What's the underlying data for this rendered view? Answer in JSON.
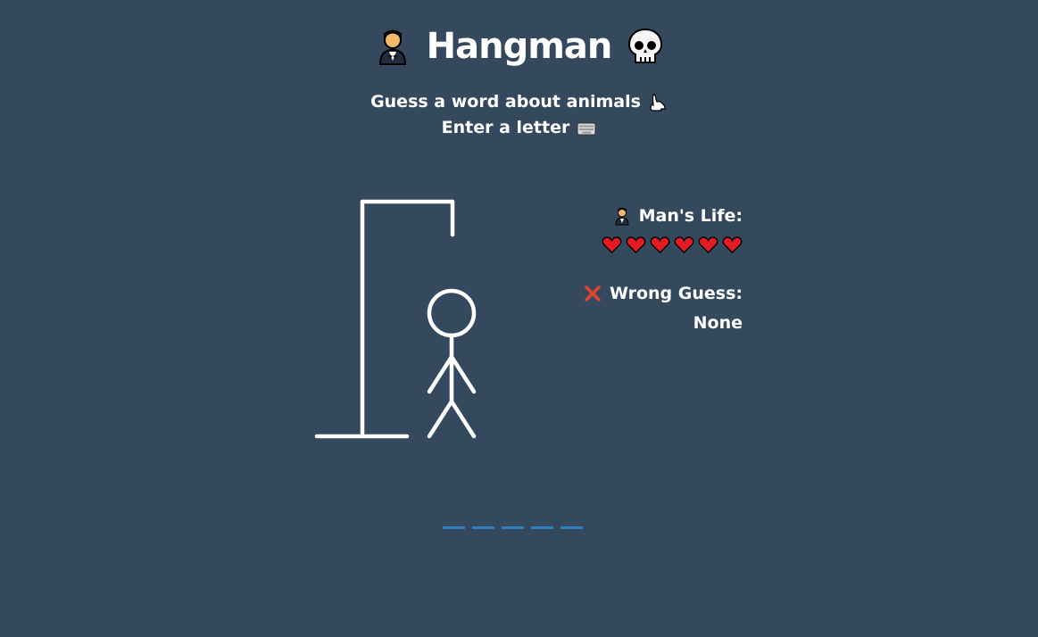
{
  "header": {
    "title": "Hangman",
    "left_icon": "man-in-tuxedo-icon",
    "right_icon": "skull-icon",
    "subtitle_line1": "Guess a word about animals",
    "subtitle_line1_icon": "rabbit-icon",
    "subtitle_line2": "Enter a letter",
    "subtitle_line2_icon": "keyboard-icon"
  },
  "status": {
    "life_label": "Man's Life:",
    "life_icon": "man-in-tuxedo-icon",
    "lives": 6,
    "heart_color": "#e51b23",
    "wrong_label": "Wrong Guess:",
    "wrong_icon": "cross-icon",
    "wrong_value": "None"
  },
  "word": {
    "length": 5,
    "blank_color": "#2f7fc1"
  },
  "colors": {
    "background": "#34495e",
    "text": "#ffffff"
  }
}
